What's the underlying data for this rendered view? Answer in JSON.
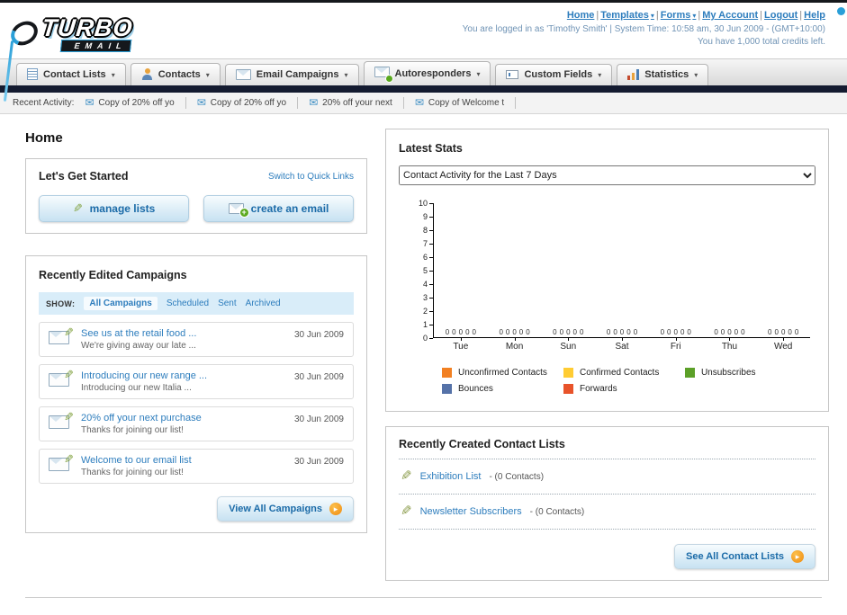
{
  "colors": {
    "link": "#2d7dbd",
    "dark_bar": "#141b30",
    "accent_blue": "#2a9fd8",
    "button_text": "#1b6ba8"
  },
  "header": {
    "logo_title": "TURBO",
    "logo_subtitle": "EMAIL",
    "links": [
      {
        "label": "Home"
      },
      {
        "label": "Templates"
      },
      {
        "label": "Forms"
      },
      {
        "label": "My Account"
      },
      {
        "label": "Logout"
      },
      {
        "label": "Help"
      }
    ],
    "session_line": "You are logged in as 'Timothy Smith' | System Time: 10:58 am, 30 Jun 2009 - (GMT+10:00)",
    "credits_line": "You have 1,000 total credits left."
  },
  "nav": {
    "tabs": [
      {
        "label": "Contact Lists"
      },
      {
        "label": "Contacts"
      },
      {
        "label": "Email Campaigns"
      },
      {
        "label": "Autoresponders"
      },
      {
        "label": "Custom Fields"
      },
      {
        "label": "Statistics"
      }
    ]
  },
  "activity": {
    "label": "Recent Activity:",
    "items": [
      {
        "text": "Copy of 20% off yo"
      },
      {
        "text": "Copy of 20% off yo"
      },
      {
        "text": "20% off your next"
      },
      {
        "text": "Copy of Welcome t"
      }
    ]
  },
  "page": {
    "title": "Home"
  },
  "get_started": {
    "title": "Let's Get Started",
    "switch_link": "Switch to Quick Links",
    "manage_lists_label": "manage lists",
    "create_email_label": "create an email"
  },
  "campaigns": {
    "title": "Recently Edited Campaigns",
    "show_label": "SHOW:",
    "filters": [
      "All Campaigns",
      "Scheduled",
      "Sent",
      "Archived"
    ],
    "active_filter": "All Campaigns",
    "items": [
      {
        "title": "See us at the retail food ...",
        "subtitle": "We're giving away our late ...",
        "date": "30 Jun 2009"
      },
      {
        "title": "Introducing our new range ...",
        "subtitle": "Introducing our new Italia ...",
        "date": "30 Jun 2009"
      },
      {
        "title": "20% off your next purchase",
        "subtitle": "Thanks for joining our list!",
        "date": "30 Jun 2009"
      },
      {
        "title": "Welcome to our email list",
        "subtitle": "Thanks for joining our list!",
        "date": "30 Jun 2009"
      }
    ],
    "view_all_label": "View All Campaigns"
  },
  "stats": {
    "title": "Latest Stats",
    "dropdown_value": "Contact Activity for the Last 7 Days",
    "chart_data": {
      "type": "bar",
      "title": "Contact Activity for the Last 7 Days",
      "categories": [
        "Tue",
        "Mon",
        "Sun",
        "Sat",
        "Fri",
        "Thu",
        "Wed"
      ],
      "series": [
        {
          "name": "Unconfirmed Contacts",
          "color": "#f28022",
          "values": [
            0,
            0,
            0,
            0,
            0,
            0,
            0
          ]
        },
        {
          "name": "Confirmed Contacts",
          "color": "#ffcc33",
          "values": [
            0,
            0,
            0,
            0,
            0,
            0,
            0
          ]
        },
        {
          "name": "Unsubscribes",
          "color": "#5ca028",
          "values": [
            0,
            0,
            0,
            0,
            0,
            0,
            0
          ]
        },
        {
          "name": "Bounces",
          "color": "#5572a8",
          "values": [
            0,
            0,
            0,
            0,
            0,
            0,
            0
          ]
        },
        {
          "name": "Forwards",
          "color": "#e8532a",
          "values": [
            0,
            0,
            0,
            0,
            0,
            0,
            0
          ]
        }
      ],
      "xlabel": "",
      "ylabel": "",
      "ylim": [
        0,
        10
      ],
      "grid": false,
      "legend_position": "bottom"
    }
  },
  "contact_lists": {
    "title": "Recently Created Contact Lists",
    "items": [
      {
        "name": "Exhibition List",
        "detail": "- (0 Contacts)"
      },
      {
        "name": "Newsletter Subscribers",
        "detail": "- (0 Contacts)"
      }
    ],
    "see_all_label": "See All Contact Lists"
  }
}
